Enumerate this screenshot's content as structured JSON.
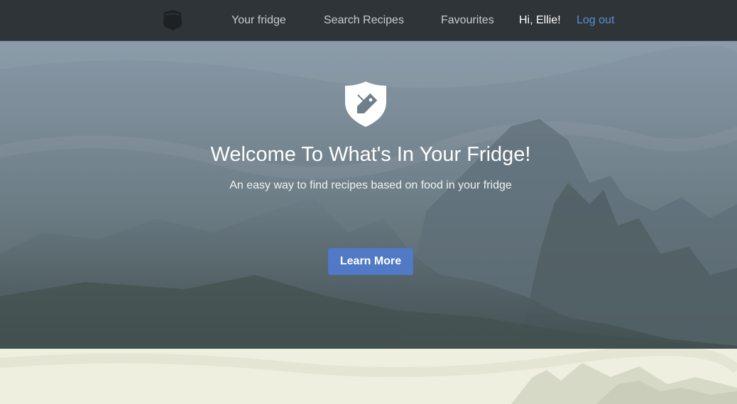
{
  "navbar": {
    "logo_icon": "shield-icon",
    "links": {
      "your_fridge": "Your fridge",
      "search_recipes": "Search Recipes",
      "favourites": "Favourites"
    },
    "greeting": "Hi, Ellie!",
    "logout": "Log out"
  },
  "hero": {
    "icon": "shield-tag-icon",
    "title": "Welcome To What's In Your Fridge!",
    "subtitle": "An easy way to find recipes based on food in your fridge",
    "button_label": "Learn More"
  },
  "colors": {
    "navbar_bg": "#2f3438",
    "link": "#c8ccd0",
    "logout_link": "#5b8fd6",
    "button_bg": "#5079c6",
    "lower_section_bg": "#eeeedf"
  }
}
